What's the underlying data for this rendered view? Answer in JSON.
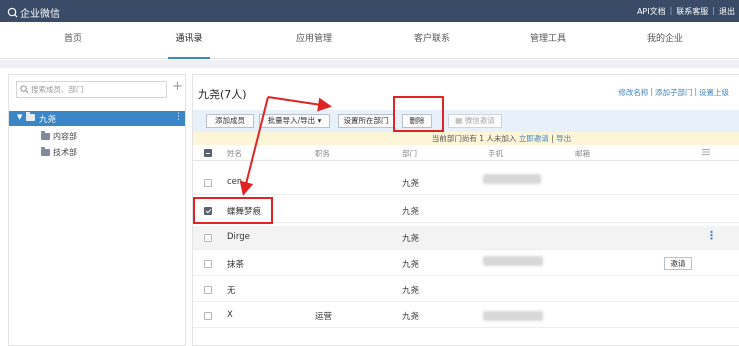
{
  "topbar": {
    "brand": "企业微信",
    "links": [
      "API文档",
      "联系客服",
      "退出"
    ]
  },
  "nav": {
    "items": [
      "首页",
      "通讯录",
      "应用管理",
      "客户联系",
      "管理工具",
      "我的企业"
    ],
    "active": "通讯录"
  },
  "sidebar": {
    "search_placeholder": "搜索成员、部门",
    "root": "九尧",
    "children": [
      "内容部",
      "技术部"
    ]
  },
  "main": {
    "title": "九尧(7人)",
    "links": [
      "修改名称",
      "添加子部门",
      "设置上级"
    ],
    "toolbar": {
      "add_member": "添加成员",
      "batch": "批量导入/导出 ▾",
      "set_dept": "设置所在部门",
      "delete": "删除",
      "wechat_invite": "微信邀请"
    },
    "notice": {
      "text": "当前部门尚有 1 人未加入",
      "invite": "立即邀请",
      "sep": "|",
      "export": "导出"
    },
    "columns": [
      "姓名",
      "职务",
      "部门",
      "手机",
      "邮箱"
    ],
    "rows": [
      {
        "name": "cen",
        "title": "",
        "dept": "九尧",
        "checked": false
      },
      {
        "name": "蝶舞梦痕",
        "title": "",
        "dept": "九尧",
        "checked": true
      },
      {
        "name": "Dirge",
        "title": "",
        "dept": "九尧",
        "checked": false
      },
      {
        "name": "抹茶",
        "title": "",
        "dept": "九尧",
        "checked": false,
        "action": "邀请"
      },
      {
        "name": "无",
        "title": "",
        "dept": "九尧",
        "checked": false
      },
      {
        "name": "X",
        "title": "运营",
        "dept": "九尧",
        "checked": false
      }
    ]
  },
  "colors": {
    "topbar": "#394b67",
    "accent": "#3b86c6",
    "annotation": "#e02424",
    "notice_bg": "#fdf5d8"
  }
}
